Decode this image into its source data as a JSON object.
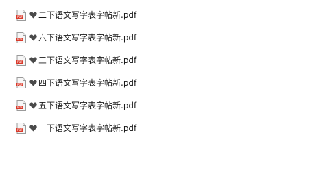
{
  "files": [
    {
      "name": "二下语文写字表字帖新.pdf",
      "icon": "pdf-file-icon",
      "prefix_icon": "heart-icon"
    },
    {
      "name": "六下语文写字表字帖新.pdf",
      "icon": "pdf-file-icon",
      "prefix_icon": "heart-icon"
    },
    {
      "name": "三下语文写字表字帖新.pdf",
      "icon": "pdf-file-icon",
      "prefix_icon": "heart-icon"
    },
    {
      "name": "四下语文写字表字帖新.pdf",
      "icon": "pdf-file-icon",
      "prefix_icon": "heart-icon"
    },
    {
      "name": "五下语文写字表字帖新.pdf",
      "icon": "pdf-file-icon",
      "prefix_icon": "heart-icon"
    },
    {
      "name": "一下语文写字表字帖新.pdf",
      "icon": "pdf-file-icon",
      "prefix_icon": "heart-icon"
    }
  ],
  "colors": {
    "pdf_badge": "#d93a2b",
    "heart": "#4a4a4a",
    "text": "#1a1a1a"
  }
}
